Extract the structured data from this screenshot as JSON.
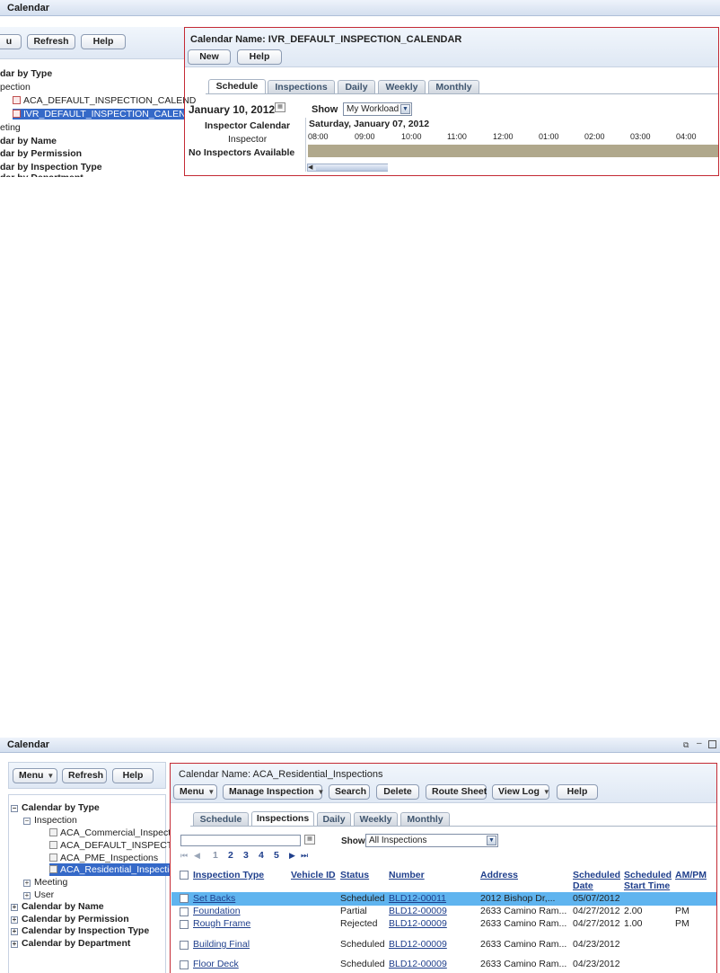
{
  "top": {
    "title": "Calendar",
    "buttons": {
      "menu_fragment": "u",
      "refresh": "Refresh",
      "help": "Help"
    },
    "tree": [
      "dar by Type",
      "pection",
      "ACA_DEFAULT_INSPECTION_CALEND",
      "IVR_DEFAULT_INSPECTION_CALENDA",
      "eting",
      "dar by Name",
      "dar by Permission",
      "dar by Inspection Type",
      "dar by Department"
    ],
    "main": {
      "calendar_name": "Calendar Name: IVR_DEFAULT_INSPECTION_CALENDAR",
      "new": "New",
      "help": "Help",
      "tabs": [
        "Schedule",
        "Inspections",
        "Daily",
        "Weekly",
        "Monthly"
      ],
      "date": "January 10, 2012",
      "show_label": "Show",
      "show_value": "My Workload",
      "inspector_calendar": "Inspector Calendar",
      "inspector": "Inspector",
      "no_inspectors": "No Inspectors Available",
      "day_heading": "Saturday, January 07, 2012",
      "times": [
        "08:00",
        "09:00",
        "10:00",
        "11:00",
        "12:00",
        "01:00",
        "02:00",
        "03:00",
        "04:00"
      ]
    }
  },
  "bottom": {
    "title": "Calendar",
    "window_icons": [
      "restore-icon",
      "minimize-icon",
      "maximize-icon"
    ],
    "buttons": {
      "menu": "Menu",
      "refresh": "Refresh",
      "help": "Help"
    },
    "tree": {
      "by_type": "Calendar by Type",
      "inspection": "Inspection",
      "items": [
        "ACA_Commercial_Inspections",
        "ACA_DEFAULT_INSPECTION",
        "ACA_PME_Inspections",
        "ACA_Residential_Inspections"
      ],
      "meeting": "Meeting",
      "user": "User",
      "by_name": "Calendar by Name",
      "by_permission": "Calendar by Permission",
      "by_inspection_type": "Calendar by Inspection Type",
      "by_department": "Calendar by Department"
    },
    "main": {
      "calendar_name": "Calendar Name: ACA_Residential_Inspections",
      "toolbar": {
        "menu": "Menu",
        "manage_inspection": "Manage Inspection",
        "search": "Search",
        "delete": "Delete",
        "route_sheet": "Route Sheet",
        "view_log": "View Log",
        "help": "Help"
      },
      "tabs": [
        "Schedule",
        "Inspections",
        "Daily",
        "Weekly",
        "Monthly"
      ],
      "date_value": "",
      "show_label": "Show",
      "show_value": "All Inspections",
      "pager": [
        "1",
        "2",
        "3",
        "4",
        "5"
      ],
      "columns": {
        "inspection_type": "Inspection Type",
        "vehicle_id": "Vehicle ID",
        "status": "Status",
        "number": "Number",
        "address": "Address",
        "scheduled_date_1": "Scheduled",
        "scheduled_date_2": "Date",
        "scheduled_start_1": "Scheduled",
        "scheduled_start_2": "Start Time",
        "ampm": "AM/PM"
      },
      "rows": [
        {
          "type": "Set Backs",
          "vehicle": "",
          "status": "Scheduled",
          "number": "BLD12-00011",
          "address": "2012 Bishop Dr,...",
          "date": "05/07/2012",
          "start": "",
          "ampm": ""
        },
        {
          "type": "Foundation",
          "vehicle": "",
          "status": "Partial",
          "number": "BLD12-00009",
          "address": "2633 Camino Ram...",
          "date": "04/27/2012",
          "start": "2.00",
          "ampm": "PM"
        },
        {
          "type": "Rough Frame",
          "vehicle": "",
          "status": "Rejected",
          "number": "BLD12-00009",
          "address": "2633 Camino Ram...",
          "date": "04/27/2012",
          "start": "1.00",
          "ampm": "PM"
        },
        {
          "type": "Building Final",
          "vehicle": "",
          "status": "Scheduled",
          "number": "BLD12-00009",
          "address": "2633 Camino Ram...",
          "date": "04/23/2012",
          "start": "",
          "ampm": ""
        },
        {
          "type": "Floor Deck",
          "vehicle": "",
          "status": "Scheduled",
          "number": "BLD12-00009",
          "address": "2633 Camino Ram...",
          "date": "04/23/2012",
          "start": "",
          "ampm": ""
        }
      ]
    }
  }
}
